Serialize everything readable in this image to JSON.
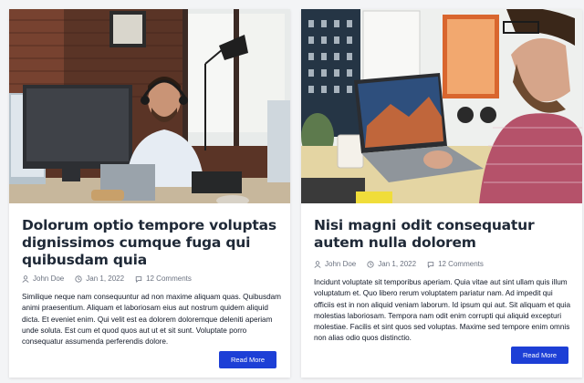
{
  "posts": [
    {
      "title": "Dolorum optio tempore voluptas dignissimos cumque fuga qui quibusdam quia",
      "author": "John Doe",
      "date": "Jan 1, 2022",
      "comments": "12 Comments",
      "excerpt": "Similique neque nam consequuntur ad non maxime aliquam quas. Quibusdam animi praesentium. Aliquam et laboriosam eius aut nostrum quidem aliquid dicta. Et eveniet enim. Qui velit est ea dolorem doloremque deleniti aperiam unde soluta. Est cum et quod quos aut ut et sit sunt. Voluptate porro consequatur assumenda perferendis dolore.",
      "button_label": "Read More",
      "photo_icon": "office-man-with-headset-photo"
    },
    {
      "title": "Nisi magni odit consequatur autem nulla dolorem",
      "author": "John Doe",
      "date": "Jan 1, 2022",
      "comments": "12 Comments",
      "excerpt": "Incidunt voluptate sit temporibus aperiam. Quia vitae aut sint ullam quis illum voluptatum et. Quo libero rerum voluptatem pariatur nam. Ad impedit qui officiis est in non aliquid veniam laborum. Id ipsum qui aut. Sit aliquam et quia molestias laboriosam. Tempora nam odit enim corrupti qui aliquid excepturi molestiae. Facilis et sint quos sed voluptas. Maxime sed tempore enim omnis non alias odio quos distinctio.",
      "button_label": "Read More",
      "photo_icon": "man-with-laptop-desk-photo"
    }
  ],
  "colors": {
    "button": "#1d3fd6",
    "title": "#1f2937",
    "meta": "#6b7280",
    "background": "#f3f4f6"
  }
}
